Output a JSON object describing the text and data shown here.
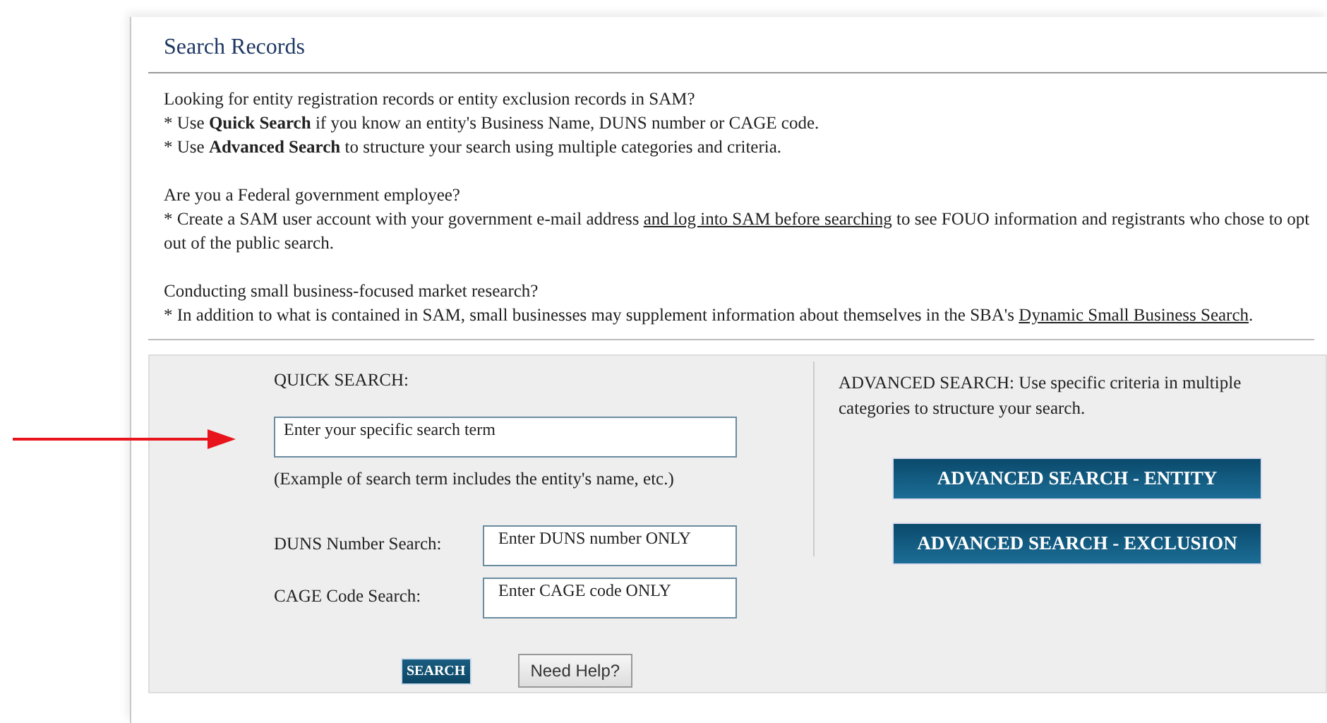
{
  "page": {
    "title": "Search Records"
  },
  "intro": [
    {
      "heading": "Looking for entity registration records or entity exclusion records in SAM?",
      "bullets": [
        [
          {
            "kind": "text",
            "text": "* Use **Quick Search** if you know an entity's Business Name, DUNS number or CAGE code."
          }
        ],
        [
          {
            "kind": "text",
            "text": "* Use **Advanced Search** to structure your search using multiple categories and criteria."
          }
        ]
      ]
    },
    {
      "heading": "Are you a Federal government employee?",
      "bullets": [
        [
          {
            "kind": "text",
            "text": "* Create a SAM user account with your government e-mail address "
          },
          {
            "kind": "link",
            "text": "and log into SAM before searching"
          },
          {
            "kind": "text",
            "text": " to see FOUO information and registrants who chose to opt out of the public search."
          }
        ]
      ]
    },
    {
      "heading": "Conducting small business-focused market research?",
      "bullets": [
        [
          {
            "kind": "text",
            "text": "* In addition to what is contained in SAM, small businesses may supplement information about themselves in the SBA's "
          },
          {
            "kind": "link",
            "text": "Dynamic Small Business Search"
          },
          {
            "kind": "text",
            "text": "."
          }
        ]
      ]
    }
  ],
  "quick_search": {
    "label": "QUICK SEARCH:",
    "search_field": {
      "placeholder": "Enter your specific search term"
    },
    "hint": "(Example of search term includes the entity's name, etc.)",
    "fields": [
      {
        "label": "DUNS Number Search:",
        "placeholder": "Enter DUNS number ONLY"
      },
      {
        "label": "CAGE Code Search:",
        "placeholder": "Enter CAGE code ONLY"
      }
    ],
    "buttons": [
      {
        "kind": "primary",
        "label": "SEARCH"
      },
      {
        "kind": "secondary",
        "label": "Need Help?"
      }
    ]
  },
  "advanced_search": {
    "text": "ADVANCED SEARCH: Use specific criteria in multiple categories to structure your search.",
    "buttons": [
      "ADVANCED SEARCH - ENTITY",
      "ADVANCED SEARCH - EXCLUSION"
    ]
  }
}
